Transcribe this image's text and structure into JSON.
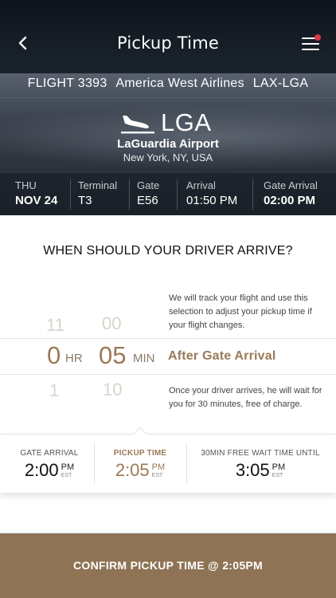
{
  "header": {
    "title": "Pickup Time",
    "back_icon": "chevron-left-icon",
    "menu_icon": "hamburger-menu-icon",
    "notification_color": "#d53a45"
  },
  "flight": {
    "number": "FLIGHT 3393",
    "airline": "America West Airlines",
    "route": "LAX-LGA",
    "dest_icon": "plane-landing-icon",
    "dest_code": "LGA",
    "airport_name": "LaGuardia Airport",
    "airport_city": "New York, NY, USA",
    "info": {
      "day": "THU",
      "date": "NOV 24",
      "terminal_label": "Terminal",
      "terminal": "T3",
      "gate_label": "Gate",
      "gate": "E56",
      "arrival_label": "Arrival",
      "arrival": "01:50 PM",
      "gate_arrival_label": "Gate Arrival",
      "gate_arrival": "02:00 PM"
    }
  },
  "question": "WHEN SHOULD YOUR DRIVER ARRIVE?",
  "picker": {
    "note_top": "We will track your flight and use this selection to adjust your pickup time if your flight changes.",
    "note_bottom": "Once your driver arrives, he will wait for you for 30 minutes, free of charge.",
    "hours_prev": "11",
    "minutes_prev": "00",
    "hours": "0",
    "hours_unit": "HR",
    "minutes": "05",
    "minutes_unit": "MIN",
    "hours_next": "1",
    "minutes_next": "10",
    "relative_to": "After Gate Arrival"
  },
  "summary": {
    "gate_arrival_label": "GATE ARRIVAL",
    "gate_arrival_time": "2:00",
    "gate_arrival_ampm": "PM",
    "gate_arrival_tz": "EST",
    "pickup_label": "PICKUP TIME",
    "pickup_time": "2:05",
    "pickup_ampm": "PM",
    "pickup_tz": "EST",
    "wait_label": "30MIN FREE WAIT TIME UNTIL",
    "wait_time": "3:05",
    "wait_ampm": "PM",
    "wait_tz": "EST"
  },
  "confirm_label": "CONFIRM PICKUP TIME @ 2:05PM",
  "colors": {
    "accent": "#9a7a57",
    "confirm_bg": "#8e7354"
  }
}
